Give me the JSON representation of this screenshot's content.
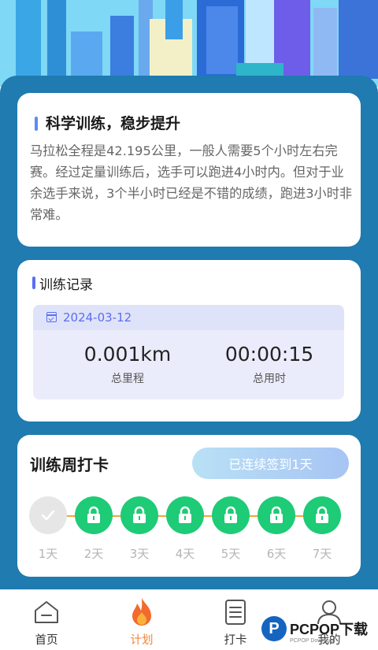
{
  "colors": {
    "panel": "#1f7bb0",
    "accent_blue": "#5b6ef0",
    "checkin_green": "#1ecb76",
    "track_orange": "#f3a43a",
    "active_tab": "#f0863a"
  },
  "intro_card": {
    "title": "科学训练，稳步提升",
    "description": "马拉松全程是42.195公里，一般人需要5个小时左右完赛。经过定量训练后，选手可以跑进4小时内。但对于业余选手来说，3个半小时已经是不错的成绩，跑进3小时非常难。"
  },
  "record_card": {
    "title": "训练记录",
    "date_icon": "calendar-check-icon",
    "date": "2024-03-12",
    "distance_value": "0.001km",
    "distance_label": "总里程",
    "time_value": "00:00:15",
    "time_label": "总用时"
  },
  "weekly_card": {
    "title": "训练周打卡",
    "streak_button": "已连续签到1天",
    "days": [
      {
        "label": "1天",
        "state": "done",
        "icon": "check-icon"
      },
      {
        "label": "2天",
        "state": "locked",
        "icon": "lock-icon"
      },
      {
        "label": "3天",
        "state": "locked",
        "icon": "lock-icon"
      },
      {
        "label": "4天",
        "state": "locked",
        "icon": "lock-icon"
      },
      {
        "label": "5天",
        "state": "locked",
        "icon": "lock-icon"
      },
      {
        "label": "6天",
        "state": "locked",
        "icon": "lock-icon"
      },
      {
        "label": "7天",
        "state": "locked",
        "icon": "lock-icon"
      }
    ]
  },
  "nav": {
    "items": [
      {
        "label": "首页",
        "icon": "home-icon"
      },
      {
        "label": "计划",
        "icon": "flame-icon",
        "active": true
      },
      {
        "label": "打卡",
        "icon": "clipboard-icon"
      },
      {
        "label": "我的",
        "icon": "user-icon"
      }
    ]
  },
  "watermark": {
    "logo_letter": "P",
    "text": "PCPOP下载",
    "subtext": "PCPOP Download"
  }
}
